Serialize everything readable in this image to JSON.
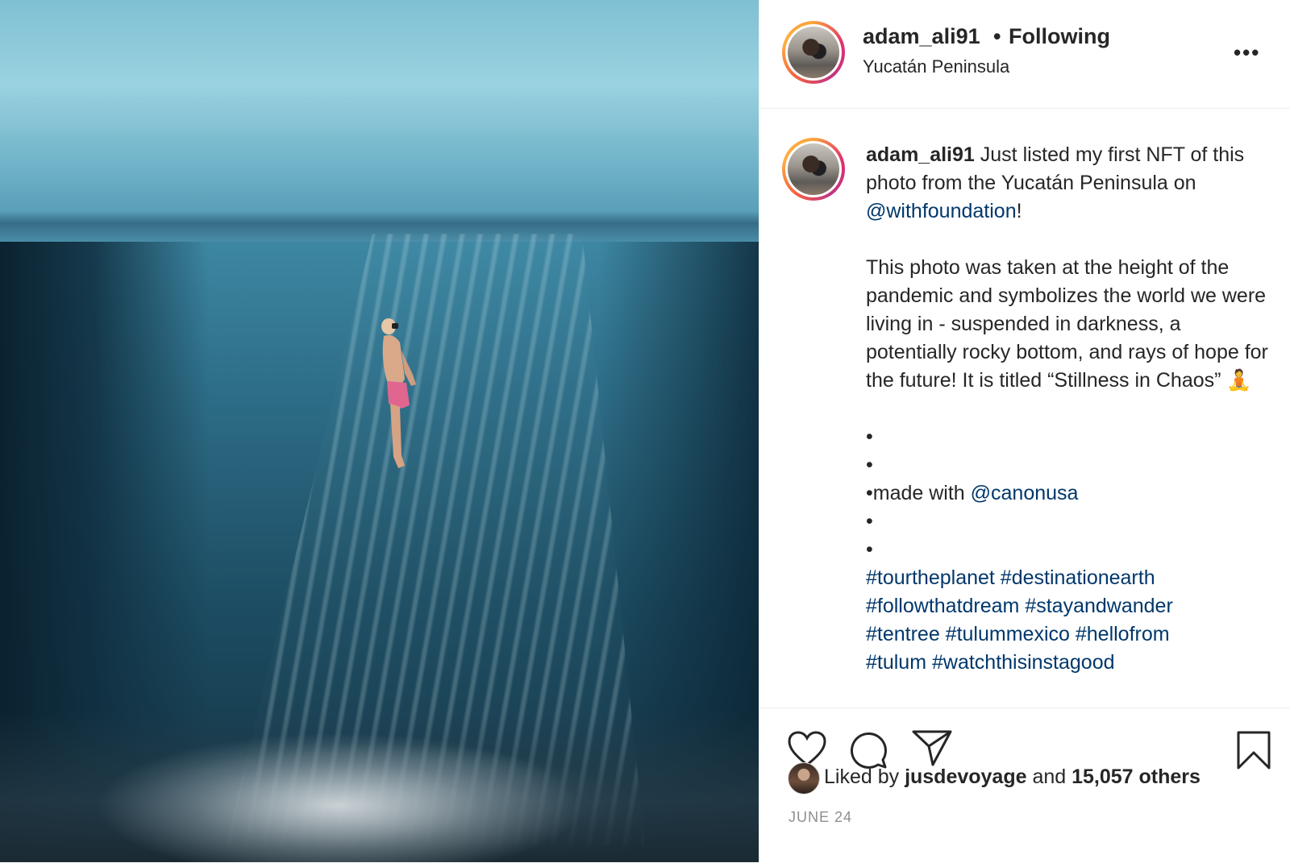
{
  "header": {
    "username": "adam_ali91",
    "separator": "•",
    "following_label": "Following",
    "location": "Yucatán Peninsula",
    "more_label": "•••"
  },
  "caption": {
    "username": "adam_ali91",
    "intro_text": " Just listed my first NFT of this photo from the Yucatán Peninsula on ",
    "foundation_mention": "@withfoundation",
    "intro_end": "!",
    "paragraph": "This photo was taken at the height of the pandemic and symbolizes the world we were living in - suspended in darkness, a potentially rocky bottom, and rays of hope for the future! It is titled “Stillness in Chaos” 🧘",
    "dot_1": "•",
    "dot_2": "•",
    "made_with_prefix": "•made with ",
    "canon_mention": "@canonusa",
    "dot_3": "•",
    "dot_4": "•",
    "hashtags_line_1": "#tourtheplanet #destinationearth",
    "hashtags_line_2": "#followthatdream #stayandwander",
    "hashtags_line_3": "#tentree #tulummexico #hellofrom",
    "hashtags_line_4": "#tulum #watchthisinstagood"
  },
  "actions": {
    "like_icon": "heart-icon",
    "comment_icon": "comment-bubble-icon",
    "share_icon": "paper-plane-icon",
    "save_icon": "bookmark-icon"
  },
  "likes": {
    "prefix": "Liked by ",
    "liker": "jusdevoyage",
    "middle": " and ",
    "others": "15,057 others"
  },
  "date": "JUNE 24"
}
